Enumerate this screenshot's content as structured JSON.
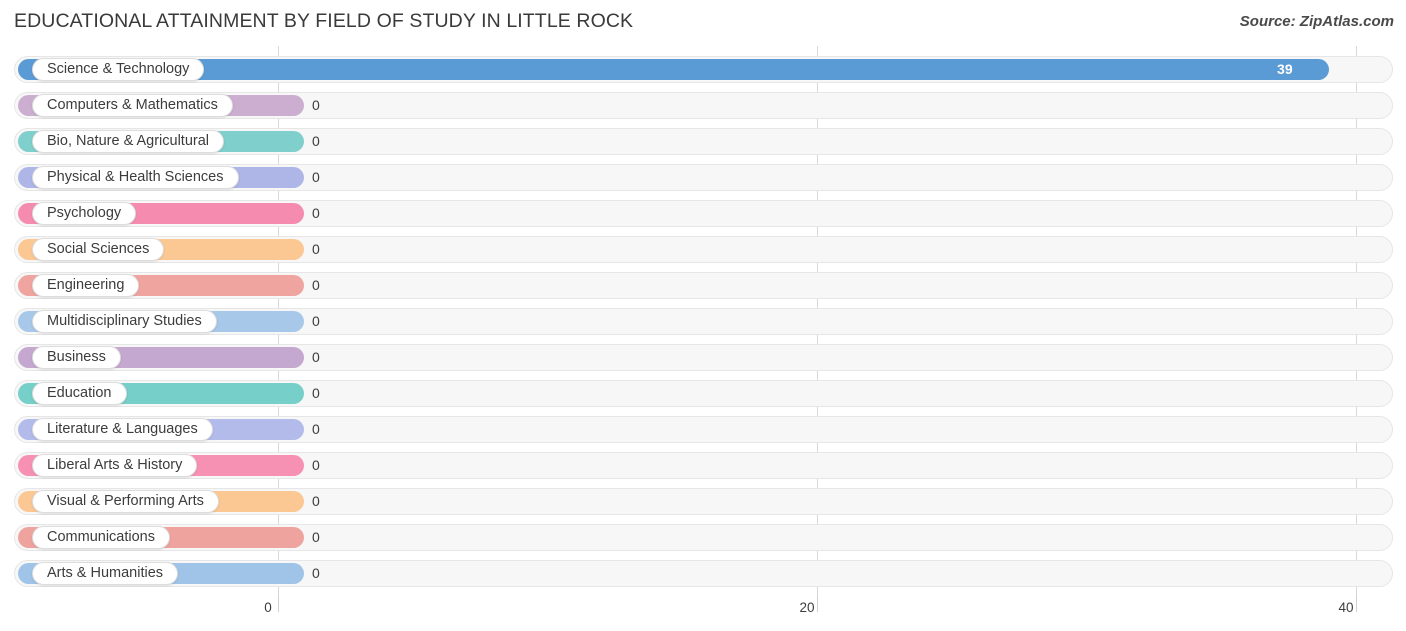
{
  "header": {
    "title": "EDUCATIONAL ATTAINMENT BY FIELD OF STUDY IN LITTLE ROCK",
    "source": "Source: ZipAtlas.com"
  },
  "chart_data": {
    "type": "bar",
    "orientation": "horizontal",
    "title": "EDUCATIONAL ATTAINMENT BY FIELD OF STUDY IN LITTLE ROCK",
    "xlabel": "",
    "ylabel": "",
    "xlim": [
      0,
      40
    ],
    "xticks": [
      0,
      20,
      40
    ],
    "xtick_labels": [
      "0",
      "20",
      "40"
    ],
    "grid": true,
    "legend": false,
    "categories": [
      "Science & Technology",
      "Computers & Mathematics",
      "Bio, Nature & Agricultural",
      "Physical & Health Sciences",
      "Psychology",
      "Social Sciences",
      "Engineering",
      "Multidisciplinary Studies",
      "Business",
      "Education",
      "Literature & Languages",
      "Liberal Arts & History",
      "Visual & Performing Arts",
      "Communications",
      "Arts & Humanities"
    ],
    "values": [
      39,
      0,
      0,
      0,
      0,
      0,
      0,
      0,
      0,
      0,
      0,
      0,
      0,
      0,
      0
    ],
    "value_labels": [
      "39",
      "0",
      "0",
      "0",
      "0",
      "0",
      "0",
      "0",
      "0",
      "0",
      "0",
      "0",
      "0",
      "0",
      "0"
    ],
    "colors": [
      "#5b9bd5",
      "#cbaed0",
      "#7fcfcd",
      "#aeb6e8",
      "#f58cb0",
      "#fbc893",
      "#f0a49f",
      "#a8c8ea",
      "#c4a8cf",
      "#76cfc8",
      "#b3bbeb",
      "#f791b3",
      "#fbc893",
      "#efa39f",
      "#9fc4e8"
    ]
  }
}
